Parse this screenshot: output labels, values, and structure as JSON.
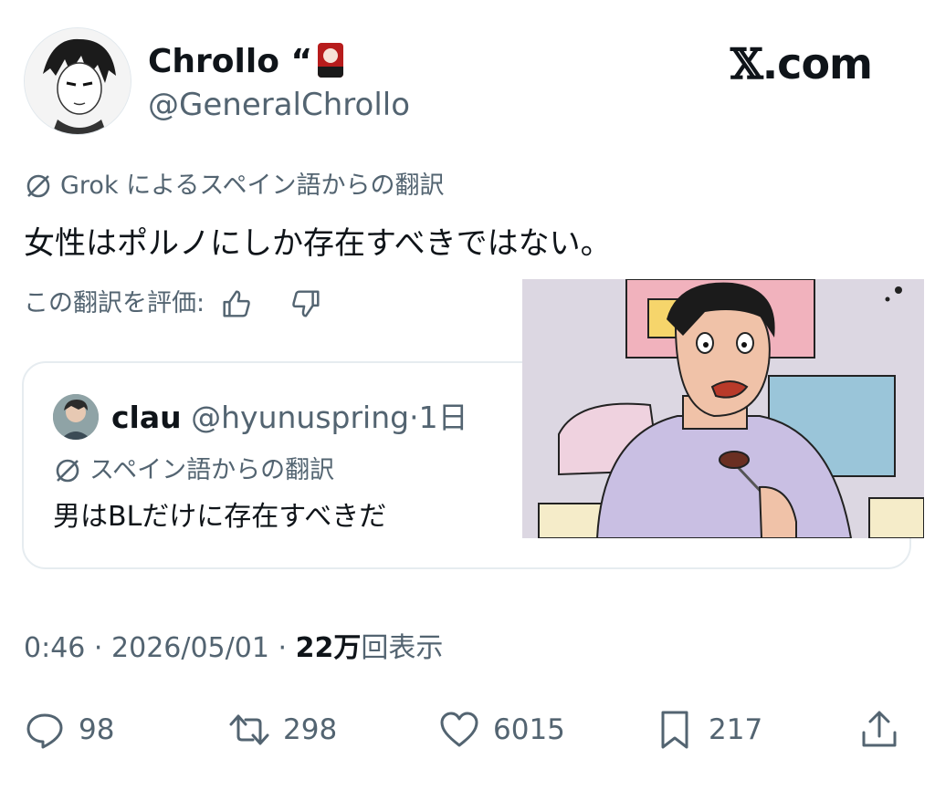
{
  "author": {
    "display_name": "Chrollo “",
    "handle": "@GeneralChrollo"
  },
  "brand": {
    "logo_x": "𝕏",
    "logo_rest": ".com"
  },
  "translation": {
    "notice": "Grok によるスペイン語からの翻訳",
    "text": "女性はポルノにしか存在すべきではない。",
    "rate_label": "この翻訳を評価:"
  },
  "quote": {
    "name": "clau",
    "handle": "@hyunuspring",
    "separator": "·",
    "time": "1日",
    "notice": "スペイン語からの翻訳",
    "text": "男はBLだけに存在すべきだ"
  },
  "meta": {
    "time": "0:46",
    "dot1": "·",
    "date": "2026/05/01",
    "dot2": "·",
    "views_count": "22万",
    "views_label": "回表示"
  },
  "actions": {
    "replies": "98",
    "reposts": "298",
    "likes": "6015",
    "bookmarks": "217"
  },
  "icons": {
    "translate": "slash-circle-icon",
    "thumbs_up": "thumbs-up-icon",
    "thumbs_down": "thumbs-down-icon",
    "reply": "reply-icon",
    "repost": "repost-icon",
    "like": "heart-icon",
    "bookmark": "bookmark-icon",
    "share": "share-icon"
  },
  "colors": {
    "text": "#0f1419",
    "muted": "#536471",
    "border": "#e6ecf0"
  }
}
